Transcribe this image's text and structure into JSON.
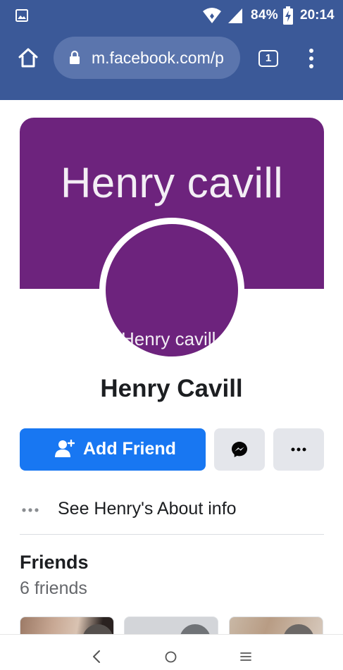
{
  "status_bar": {
    "battery": "84%",
    "time": "20:14",
    "icons": [
      "image-icon",
      "wifi-icon",
      "signal-icon",
      "battery-charging-icon"
    ]
  },
  "browser": {
    "url": "m.facebook.com/p",
    "tab_count": "1",
    "icons": [
      "home-icon",
      "lock-icon",
      "tabs-icon",
      "more-vert-icon"
    ]
  },
  "profile": {
    "cover_text": "Henry cavill",
    "avatar_text": "Henry cavill",
    "name": "Henry Cavill",
    "cover_color": "#6d237d"
  },
  "actions": {
    "add_friend": "Add Friend",
    "icons": [
      "add-friend-icon",
      "messenger-icon",
      "more-horizontal-icon"
    ],
    "primary_color": "#1877f2"
  },
  "about": {
    "label": "See Henry's About info"
  },
  "friends": {
    "title": "Friends",
    "count": "6 friends"
  },
  "nav_bar": {
    "icons": [
      "back-icon",
      "home-circle-icon",
      "recents-icon"
    ]
  }
}
